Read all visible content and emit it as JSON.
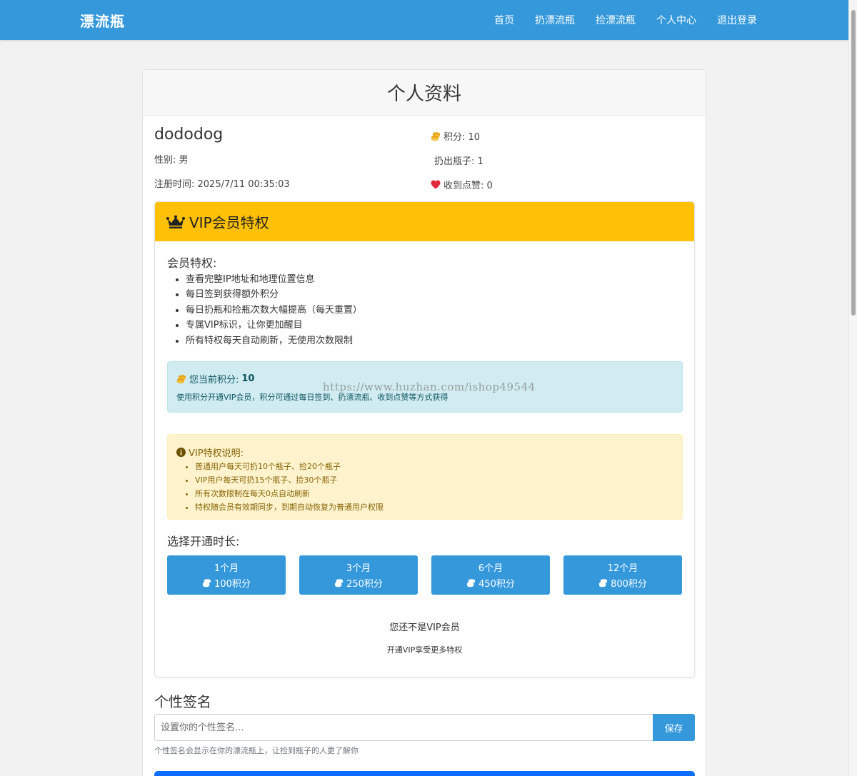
{
  "nav": {
    "brand": "漂流瓶",
    "links": [
      "首页",
      "扔漂流瓶",
      "捡漂流瓶",
      "个人中心",
      "退出登录"
    ]
  },
  "card": {
    "title": "个人资料"
  },
  "profile": {
    "username": "dododog",
    "gender": "性别: 男",
    "register_time": "注册时间: 2025/7/11 00:35:03",
    "points": "积分: 10",
    "bottles": "扔出瓶子: 1",
    "likes": "收到点赞: 0"
  },
  "vip": {
    "title": "VIP会员特权",
    "privileges_title": "会员特权:",
    "privileges": [
      "查看完整IP地址和地理位置信息",
      "每日签到获得额外积分",
      "每日扔瓶和捡瓶次数大幅提高（每天重置）",
      "专属VIP标识，让你更加醒目",
      "所有特权每天自动刷新，无使用次数限制"
    ],
    "current_points_label": "您当前积分:",
    "current_points_value": "10",
    "points_hint": "使用积分开通VIP会员，积分可通过每日签到、扔漂流瓶、收到点赞等方式获得",
    "notes_title": "VIP特权说明:",
    "notes": [
      "普通用户每天可扔10个瓶子、捡20个瓶子",
      "VIP用户每天可扔15个瓶子、捡30个瓶子",
      "所有次数限制在每天0点自动刷新",
      "特权随会员有效期同步，到期自动恢复为普通用户权限"
    ],
    "duration_title": "选择开通时长:",
    "plans": [
      {
        "duration": "1个月",
        "price": "100积分"
      },
      {
        "duration": "3个月",
        "price": "250积分"
      },
      {
        "duration": "6个月",
        "price": "450积分"
      },
      {
        "duration": "12个月",
        "price": "800积分"
      }
    ],
    "status": "您还不是VIP会员",
    "status_hint": "开通VIP享受更多特权"
  },
  "signature": {
    "title": "个性签名",
    "placeholder": "设置你的个性签名...",
    "save": "保存",
    "hint": "个性签名会显示在你的漂流瓶上，让捡到瓶子的人更了解你"
  },
  "watermark": "https://www.huzhan.com/ishop49544",
  "colors": {
    "primary": "#3498db",
    "vip": "#ffc107",
    "info_bg": "#d1ecf1",
    "warn_bg": "#fff3cd",
    "heart": "#e0293b"
  }
}
